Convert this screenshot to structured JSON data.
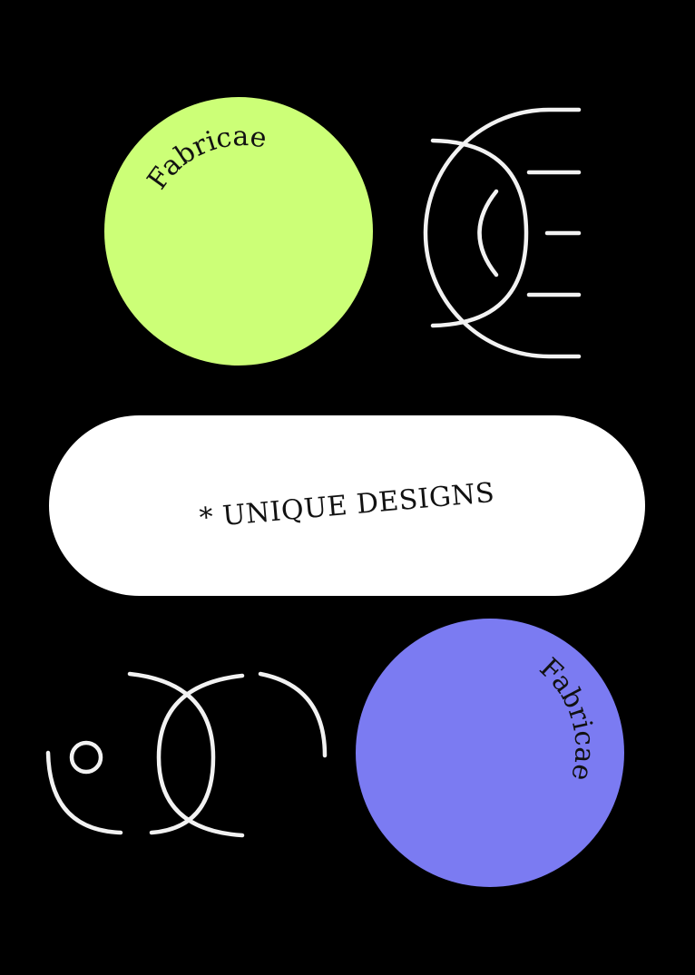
{
  "brand_top": "Fabricae",
  "brand_bottom": "Fabricae",
  "tagline": "* UNIQUE DESIGNS",
  "colors": {
    "background": "#000000",
    "green_circle": "#CCFF77",
    "blue_circle": "#7B7BF2",
    "pill": "#FFFFFF",
    "line_art": "#F2F2F2"
  },
  "icons": [
    "eye-lines-emblem-icon",
    "dot-intersecting-arcs-emblem-icon"
  ]
}
